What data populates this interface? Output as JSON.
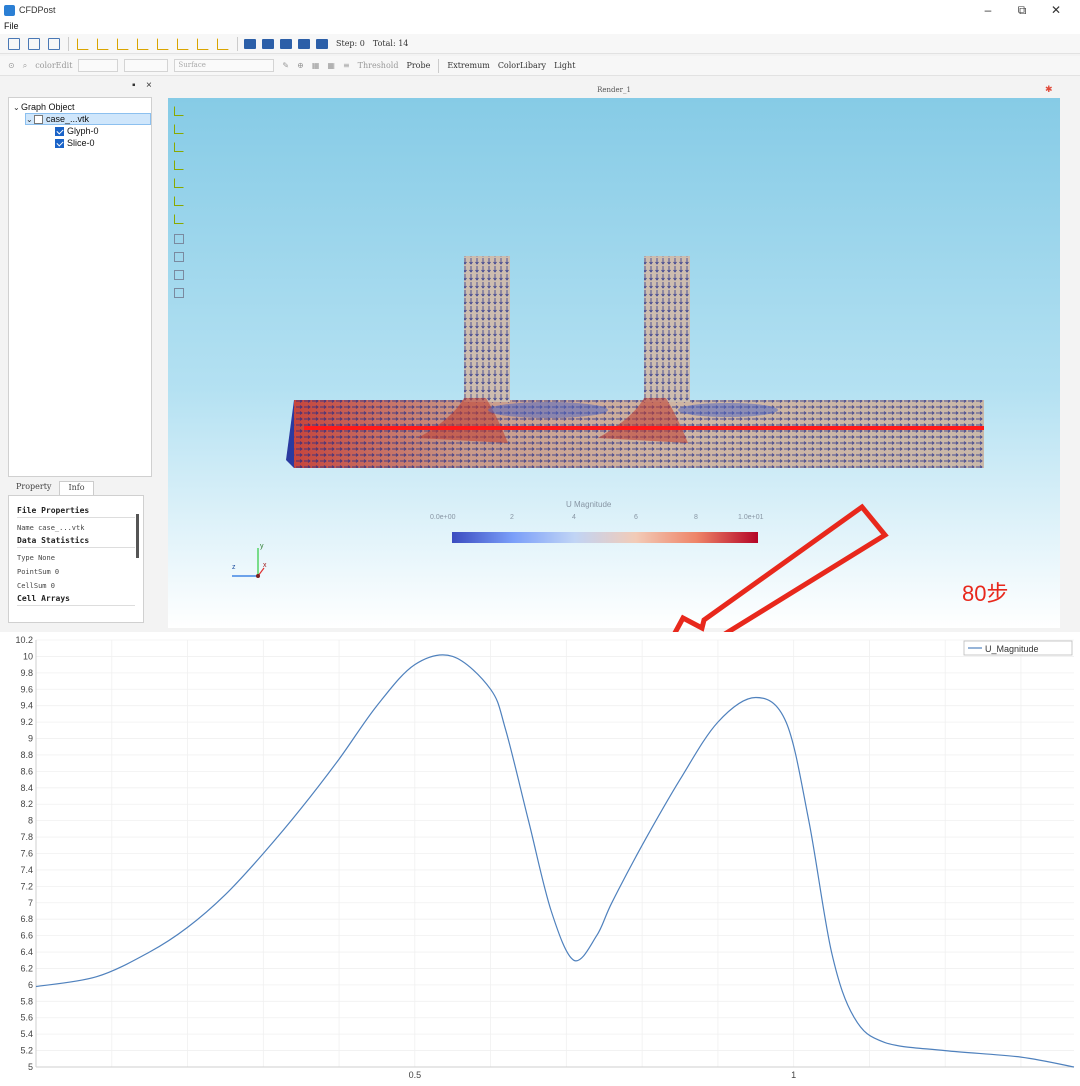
{
  "window": {
    "title": "CFDPost",
    "controls": [
      "–",
      "⧉",
      "✕"
    ]
  },
  "menu": [
    "File"
  ],
  "toolbar1": {
    "step_label": "Step: 0",
    "total_label": "Total: 14"
  },
  "toolbar2": {
    "color_edit": "colorEdit",
    "surface": "Surface",
    "threshold": "Threshold",
    "probe": "Probe",
    "extremum": "Extremum",
    "color_library": "ColorLibary",
    "light": "Light"
  },
  "tree": {
    "root": "Graph Object",
    "file": "case_...vtk",
    "children": [
      "Glyph-0",
      "Slice-0"
    ]
  },
  "tabs": [
    "Property",
    "Info"
  ],
  "info": {
    "file_properties": "File Properties",
    "name": "Name    case_...vtk",
    "data_statistics": "Data Statistics",
    "type": "Type    None",
    "pointsum": "PointSum  0",
    "cellsum": "CellSum  0",
    "cell_arrays": "Cell Arrays"
  },
  "render": {
    "title": "Render_1",
    "scalar_bar_title": "U Magnitude",
    "scalar_bar_labels": [
      "0.0e+00",
      "2",
      "4",
      "6",
      "8",
      "1.0e+01"
    ],
    "axes": [
      "y",
      "z",
      "x"
    ]
  },
  "annotation": "80步",
  "colors": {
    "background_top": "#86cbe6",
    "slice_line": "#ff1a1a",
    "arrow": "#e8281c",
    "plot_line": "#4f81bd"
  },
  "chart_data": {
    "type": "line",
    "title": "",
    "xlabel": "",
    "ylabel": "",
    "xlim": [
      0.0,
      1.37
    ],
    "ylim": [
      5.0,
      10.2
    ],
    "xticks": [
      "0.5",
      "1"
    ],
    "yticks": [
      "5",
      "5.2",
      "5.4",
      "5.6",
      "5.8",
      "6",
      "6.2",
      "6.4",
      "6.6",
      "6.8",
      "7",
      "7.2",
      "7.4",
      "7.6",
      "7.8",
      "8",
      "8.2",
      "8.4",
      "8.6",
      "8.8",
      "9",
      "9.2",
      "9.4",
      "9.6",
      "9.8",
      "10",
      "10.2"
    ],
    "legend": "top-right",
    "grid": true,
    "series": [
      {
        "name": "U_Magnitude",
        "x": [
          0.0,
          0.08,
          0.15,
          0.2,
          0.25,
          0.3,
          0.35,
          0.4,
          0.45,
          0.5,
          0.55,
          0.6,
          0.62,
          0.65,
          0.68,
          0.71,
          0.74,
          0.76,
          0.8,
          0.85,
          0.9,
          0.95,
          0.99,
          1.02,
          1.05,
          1.08,
          1.12,
          1.2,
          1.3,
          1.37
        ],
        "y": [
          5.98,
          6.1,
          6.4,
          6.7,
          7.1,
          7.6,
          8.15,
          8.75,
          9.4,
          9.9,
          10.0,
          9.6,
          9.1,
          8.0,
          6.9,
          6.3,
          6.6,
          7.0,
          7.7,
          8.5,
          9.2,
          9.5,
          9.2,
          8.0,
          6.4,
          5.6,
          5.3,
          5.2,
          5.12,
          5.0
        ]
      }
    ]
  }
}
